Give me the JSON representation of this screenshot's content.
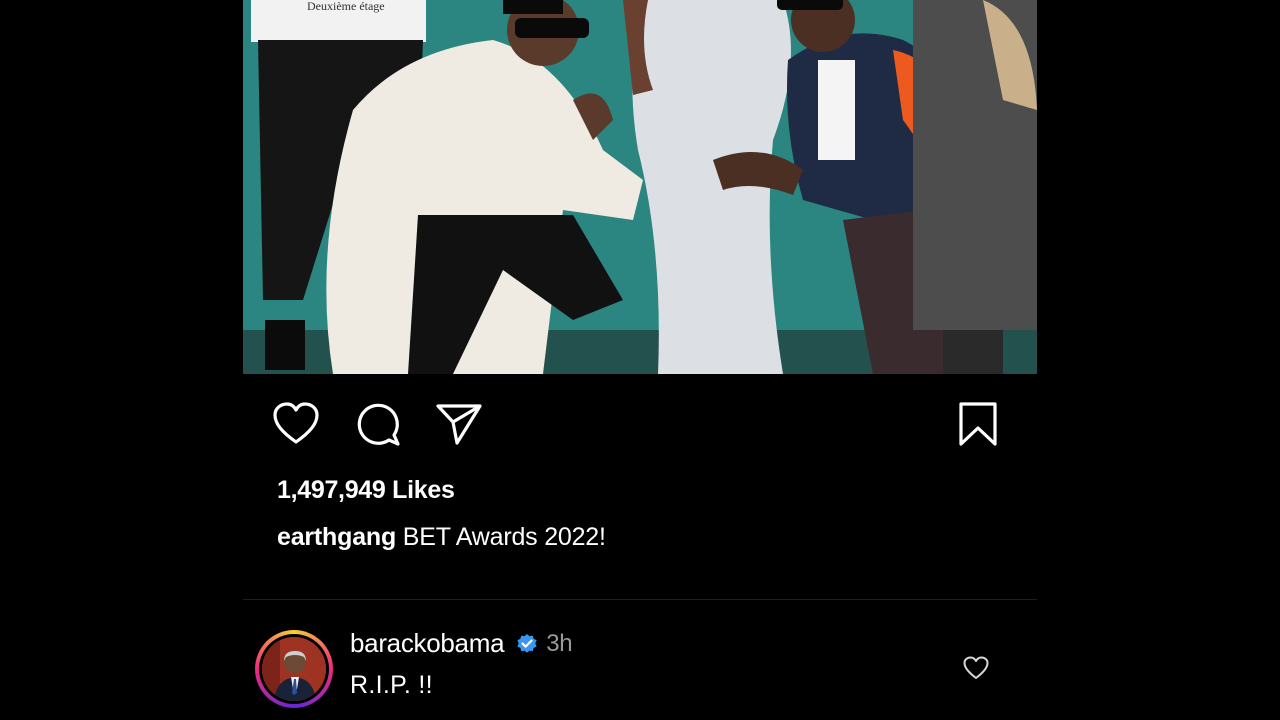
{
  "post": {
    "photo_alt": "post-photo",
    "shirt_text": "Deuxième étage",
    "likes": "1,497,949 Likes",
    "caption_user": "earthgang",
    "caption_text": " BET Awards 2022!"
  },
  "actions": {
    "like_icon": "heart-icon",
    "comment_icon": "comment-icon",
    "share_icon": "send-icon",
    "save_icon": "bookmark-icon"
  },
  "comment": {
    "username": "barackobama",
    "time": "3h",
    "text": "R.I.P. !!",
    "verified_color": "#3897f0"
  },
  "colors": {
    "background": "#000000",
    "text": "#ffffff",
    "muted": "#9a9a9a",
    "divider": "#1e1e1e"
  }
}
